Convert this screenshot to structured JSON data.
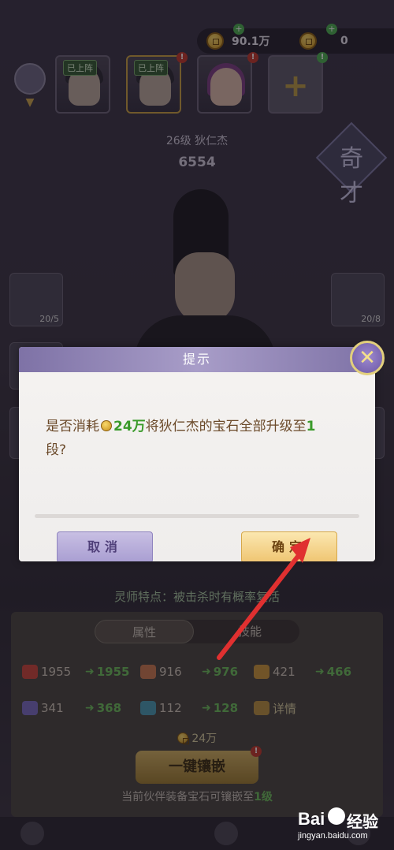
{
  "topbar": {
    "gold": {
      "icon": "gold-coin-icon",
      "value": "90.1万"
    },
    "ticket": {
      "icon": "ticket-coin-icon",
      "value": "0"
    }
  },
  "partners": {
    "slots": [
      {
        "tag": "已上阵",
        "selected": false
      },
      {
        "tag": "已上阵",
        "selected": true
      },
      {
        "tag": "",
        "selected": false
      },
      {
        "tag": "",
        "selected": false
      }
    ]
  },
  "hero": {
    "level_name": "26级 狄仁杰",
    "power": "6554",
    "rank": "奇才"
  },
  "side_slots": {
    "left_level": "20/5",
    "right_level": "20/8"
  },
  "special": "灵师特点：被击杀时有概率复活",
  "subtabs": [
    "属性",
    "技能"
  ],
  "stats": {
    "row1": [
      {
        "icon": "heart-icon",
        "value": "1955",
        "up": "1955"
      },
      {
        "icon": "sword-icon",
        "value": "916",
        "up": "976"
      },
      {
        "icon": "shield-icon",
        "value": "421",
        "up": "466"
      }
    ],
    "row2": [
      {
        "icon": "defense-icon",
        "value": "341",
        "up": "368"
      },
      {
        "icon": "boot-icon",
        "value": "112",
        "up": "128"
      },
      {
        "icon": "search-icon",
        "value": "",
        "up": "详情"
      }
    ]
  },
  "cost": "24万",
  "embed_button": "一键镶嵌",
  "embed_note_prefix": "当前伙伴装备宝石可镶嵌至",
  "embed_note_level": "1级",
  "dialog": {
    "title": "提示",
    "msg_prefix": "是否消耗",
    "msg_cost": "24万",
    "msg_middle": "将狄仁杰的宝石全部升级至",
    "msg_level": "1",
    "msg_suffix": "段?",
    "cancel": "取消",
    "ok": "确定"
  },
  "watermark": {
    "logo": "Bai",
    "suffix": "经验",
    "url": "jingyan.baidu.com"
  },
  "colors": {
    "accent": "#7e72a6",
    "gold": "#efc572",
    "green": "#3a9a2a",
    "annotation": "#e03030"
  }
}
